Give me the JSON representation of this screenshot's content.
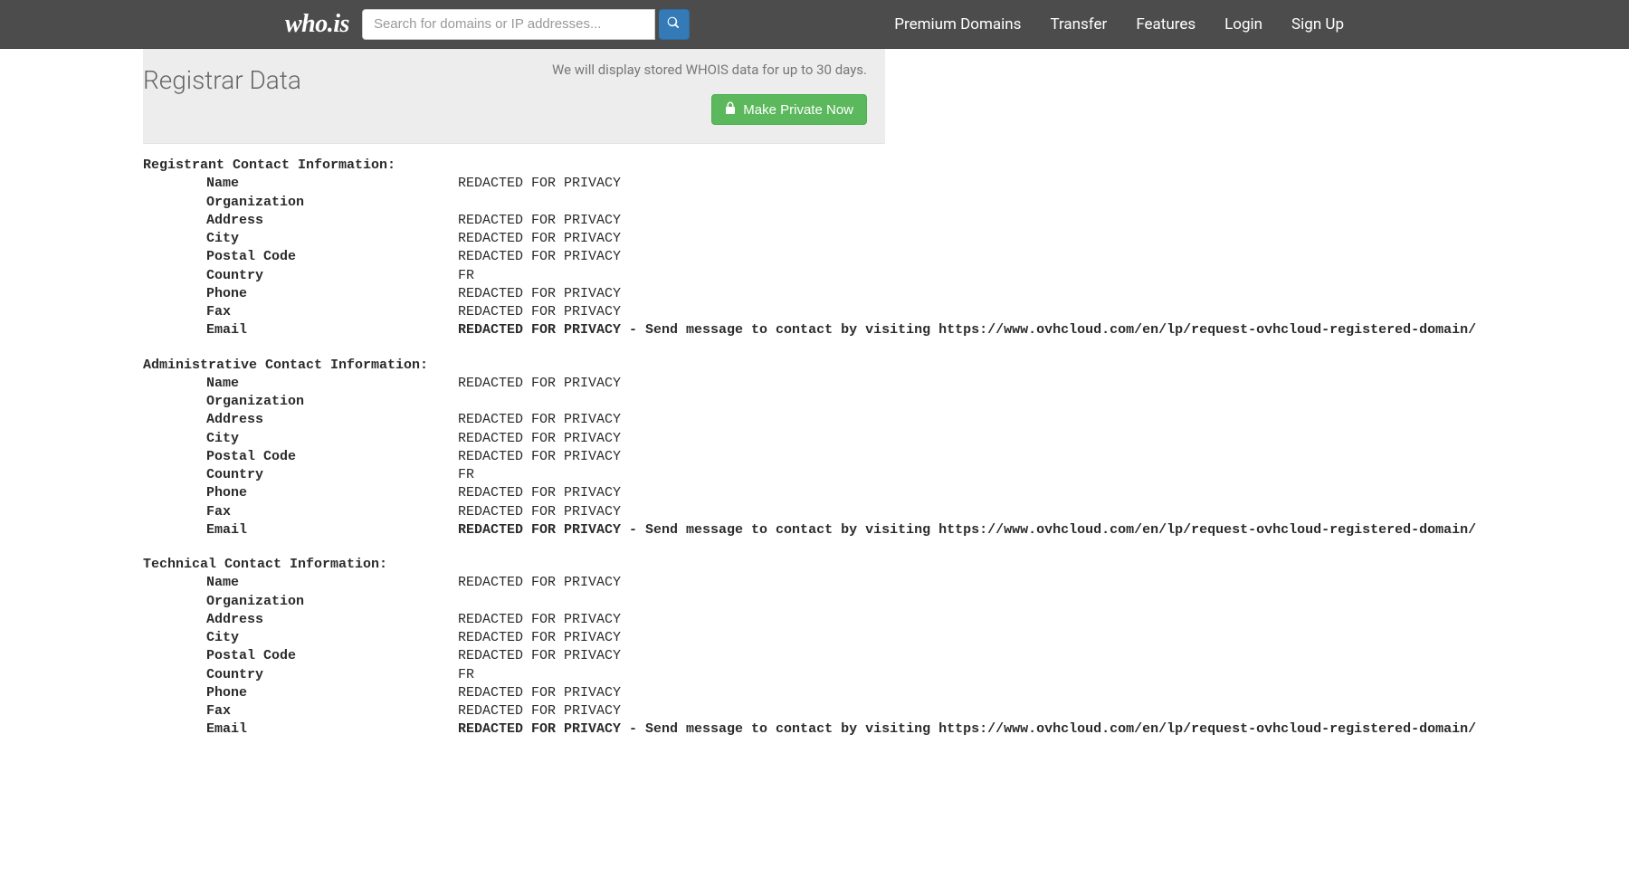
{
  "nav": {
    "logo_text": "who.is",
    "search_placeholder": "Search for domains or IP addresses...",
    "links": {
      "premium": "Premium Domains",
      "transfer": "Transfer",
      "features": "Features",
      "login": "Login",
      "signup": "Sign Up"
    }
  },
  "header": {
    "title": "Registrar Data",
    "note": "We will display stored WHOIS data for up to 30 days.",
    "make_private_label": "Make Private Now"
  },
  "redacted": "REDACTED FOR PRIVACY",
  "email_redacted": "REDACTED FOR PRIVACY - Send message to contact by visiting https://www.ovhcloud.com/en/lp/request-ovhcloud-registered-domain/",
  "country_value": "FR",
  "sections": {
    "registrant": {
      "title": "Registrant Contact Information:",
      "labels": {
        "name": "Name",
        "organization": "Organization",
        "address": "Address",
        "city": "City",
        "postal_code": "Postal Code",
        "country": "Country",
        "phone": "Phone",
        "fax": "Fax",
        "email": "Email"
      }
    },
    "administrative": {
      "title": "Administrative Contact Information:",
      "labels": {
        "name": "Name",
        "organization": "Organization",
        "address": "Address",
        "city": "City",
        "postal_code": "Postal Code",
        "country": "Country",
        "phone": "Phone",
        "fax": "Fax",
        "email": "Email"
      }
    },
    "technical": {
      "title": "Technical Contact Information:",
      "labels": {
        "name": "Name",
        "organization": "Organization",
        "address": "Address",
        "city": "City",
        "postal_code": "Postal Code",
        "country": "Country",
        "phone": "Phone",
        "fax": "Fax",
        "email": "Email"
      }
    }
  }
}
